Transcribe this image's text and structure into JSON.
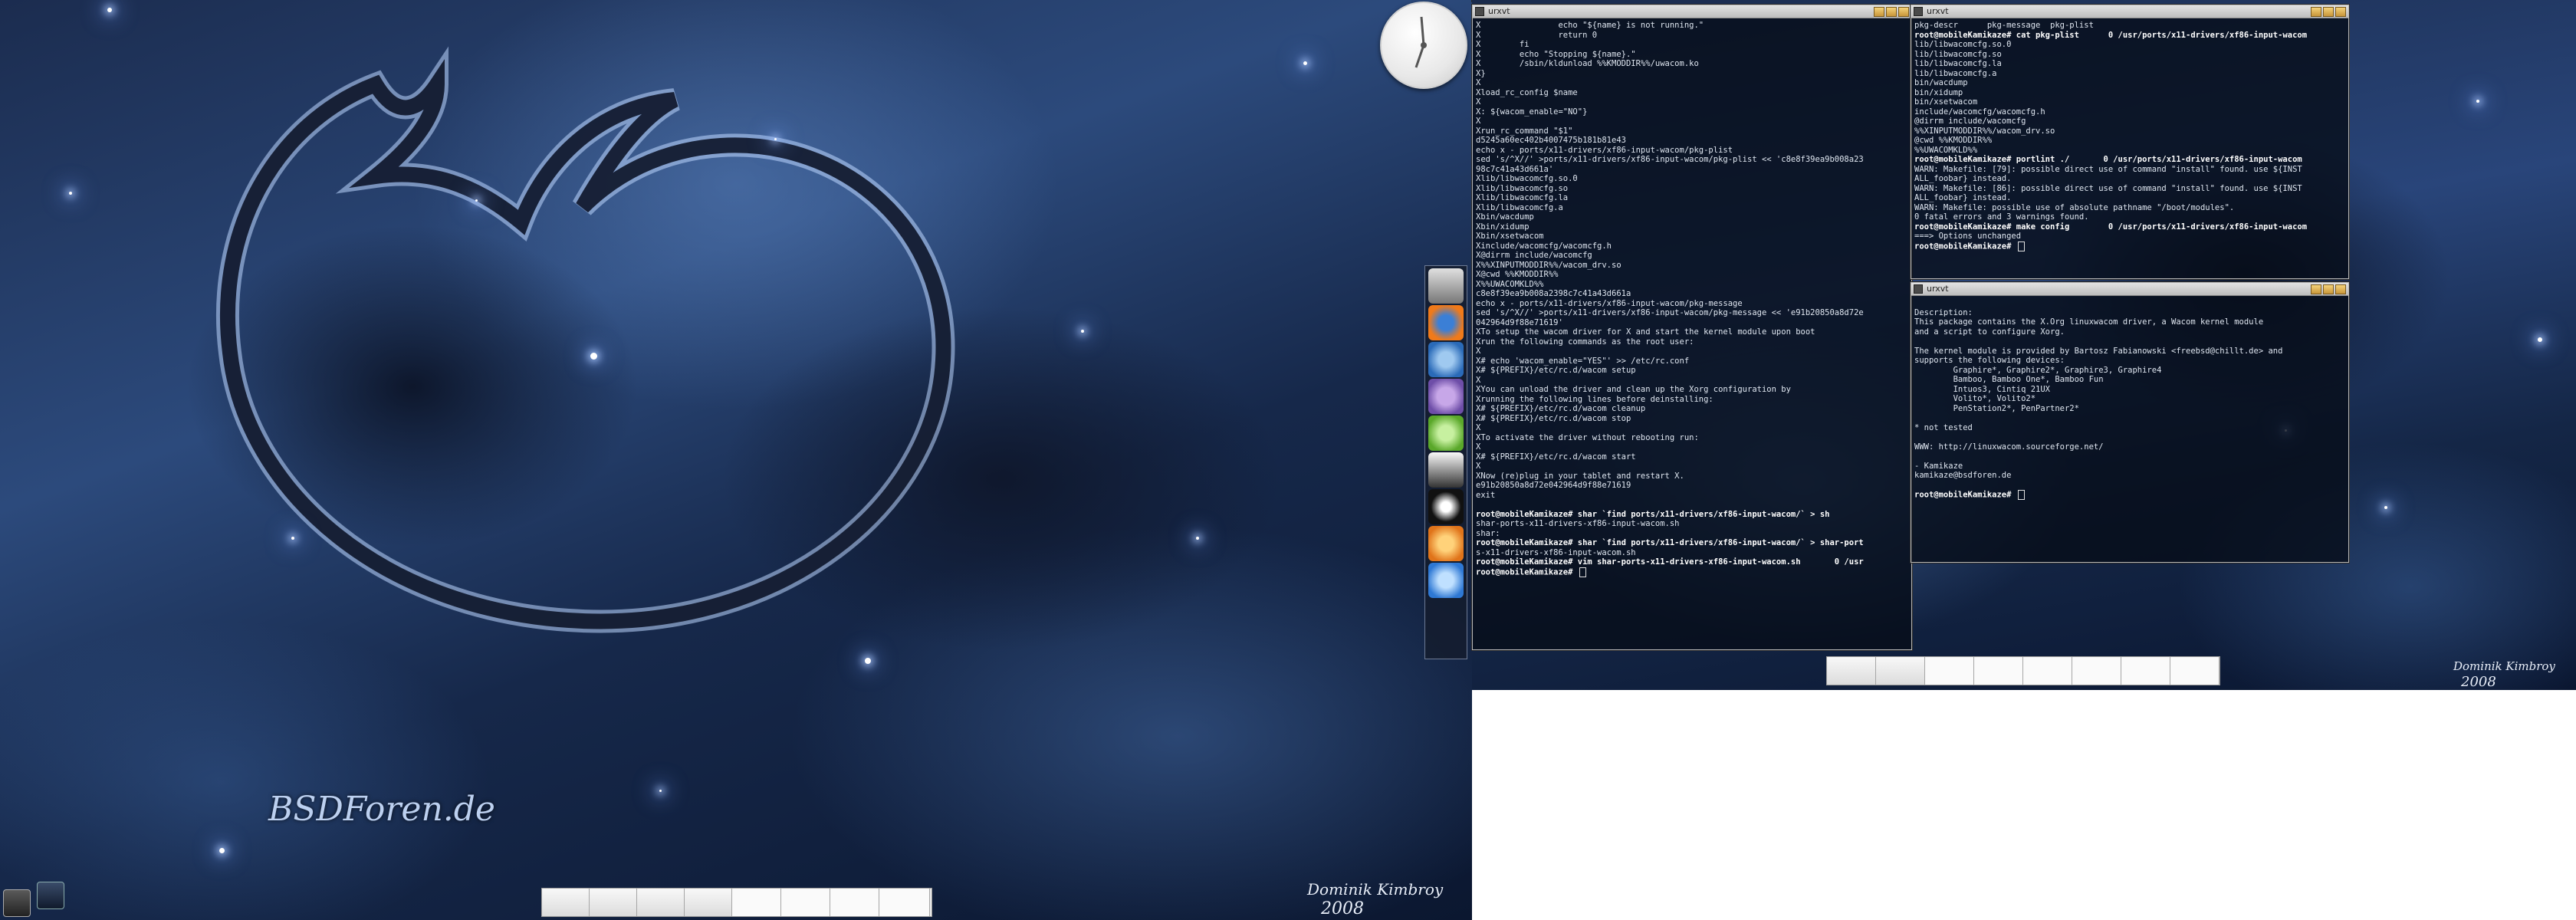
{
  "left_screen": {
    "brand_text": "BSDForen.de",
    "signature": "Dominik Kimbroy",
    "year": "2008"
  },
  "right_screen": {
    "signature": "Dominik Kimbroy",
    "year": "2008"
  },
  "main_terminal": {
    "title": "urxvt",
    "lines": [
      "X                echo \"${name} is not running.\"",
      "X                return 0",
      "X        fi",
      "X        echo \"Stopping ${name}.\"",
      "X        /sbin/kldunload %%KMODDIR%%/uwacom.ko",
      "X}",
      "X",
      "Xload_rc_config $name",
      "X",
      "X: ${wacom_enable=\"NO\"}",
      "X",
      "Xrun_rc_command \"$1\"",
      "d5245a60ec402b4007475b181b81e43",
      "echo x - ports/x11-drivers/xf86-input-wacom/pkg-plist",
      "sed 's/^X//' >ports/x11-drivers/xf86-input-wacom/pkg-plist << 'c8e8f39ea9b008a23",
      "98c7c41a43d661a'",
      "Xlib/libwacomcfg.so.0",
      "Xlib/libwacomcfg.so",
      "Xlib/libwacomcfg.la",
      "Xlib/libwacomcfg.a",
      "Xbin/wacdump",
      "Xbin/xidump",
      "Xbin/xsetwacom",
      "Xinclude/wacomcfg/wacomcfg.h",
      "X@dirrm include/wacomcfg",
      "X%%XINPUTMODDIR%%/wacom_drv.so",
      "X@cwd %%KMODDIR%%",
      "X%%UWACOMKLD%%",
      "c8e8f39ea9b008a2398c7c41a43d661a",
      "echo x - ports/x11-drivers/xf86-input-wacom/pkg-message",
      "sed 's/^X//' >ports/x11-drivers/xf86-input-wacom/pkg-message << 'e91b20850a8d72e",
      "042964d9f88e71619'",
      "XTo setup the wacom driver for X and start the kernel module upon boot",
      "Xrun the following commands as the root user:",
      "X",
      "X# echo 'wacom_enable=\"YES\"' >> /etc/rc.conf",
      "X# ${PREFIX}/etc/rc.d/wacom setup",
      "X",
      "XYou can unload the driver and clean up the Xorg configuration by",
      "Xrunning the following lines before deinstalling:",
      "X# ${PREFIX}/etc/rc.d/wacom cleanup",
      "X# ${PREFIX}/etc/rc.d/wacom stop",
      "X",
      "XTo activate the driver without rebooting run:",
      "X",
      "X# ${PREFIX}/etc/rc.d/wacom start",
      "X",
      "XNow (re)plug in your tablet and restart X.",
      "e91b20850a8d72e042964d9f88e71619",
      "exit",
      ""
    ],
    "prompt_lines": [
      "root@mobileKamikaze# shar `find ports/x11-drivers/xf86-input-wacom/` > sh",
      "shar-ports-x11-drivers-xf86-input-wacom.sh",
      "shar: ",
      "root@mobileKamikaze# shar `find ports/x11-drivers/xf86-input-wacom/` > shar-port",
      "s-x11-drivers-xf86-input-wacom.sh",
      "root@mobileKamikaze# vim shar-ports-x11-drivers-xf86-input-wacom.sh       0 /usr",
      "root@mobileKamikaze# "
    ]
  },
  "top_right_terminal": {
    "title": "urxvt",
    "lines": [
      "pkg-descr      pkg-message  pkg-plist",
      "root@mobileKamikaze# cat pkg-plist      0 /usr/ports/x11-drivers/xf86-input-wacom",
      "lib/libwacomcfg.so.0",
      "lib/libwacomcfg.so",
      "lib/libwacomcfg.la",
      "lib/libwacomcfg.a",
      "bin/wacdump",
      "bin/xidump",
      "bin/xsetwacom",
      "include/wacomcfg/wacomcfg.h",
      "@dirrm include/wacomcfg",
      "%%XINPUTMODDIR%%/wacom_drv.so",
      "@cwd %%KMODDIR%%",
      "%%UWACOMKLD%%",
      "root@mobileKamikaze# portlint ./       0 /usr/ports/x11-drivers/xf86-input-wacom",
      "WARN: Makefile: [79]: possible direct use of command \"install\" found. use ${INST",
      "ALL_foobar} instead.",
      "WARN: Makefile: [86]: possible direct use of command \"install\" found. use ${INST",
      "ALL_foobar} instead.",
      "WARN: Makefile: possible use of absolute pathname \"/boot/modules\".",
      "0 fatal errors and 3 warnings found.",
      "root@mobileKamikaze# make config        0 /usr/ports/x11-drivers/xf86-input-wacom",
      "===> Options unchanged",
      "root@mobileKamikaze# "
    ]
  },
  "bottom_right_terminal": {
    "title": "urxvt",
    "lines": [
      "",
      "Description:",
      "This package contains the X.Org linuxwacom driver, a Wacom kernel module",
      "and a script to configure Xorg.",
      "",
      "The kernel module is provided by Bartosz Fabianowski <freebsd@chillt.de> and",
      "supports the following devices:",
      "        Graphire*, Graphire2*, Graphire3, Graphire4",
      "        Bamboo, Bamboo One*, Bamboo Fun",
      "        Intuos3, Cintiq 21UX",
      "        Volito*, Volito2*",
      "        PenStation2*, PenPartner2*",
      "",
      "* not tested",
      "",
      "WWW: http://linuxwacom.sourceforge.net/",
      "",
      "- Kamikaze",
      "kamikaze@bsdforen.de",
      "",
      "root@mobileKamikaze# "
    ]
  },
  "dock": {
    "items": [
      "monitor-icon",
      "firefox-icon",
      "thunderbird-icon",
      "pidgin-icon",
      "skype-icon",
      "inkscape-icon",
      "blender-icon",
      "vlc-icon",
      "music-icon"
    ]
  },
  "colors": {
    "terminal_bg": "#060c18",
    "terminal_text": "#dfe6f0",
    "titlebar": "#d6d6d6",
    "wallpaper": "#2c4a7c"
  }
}
